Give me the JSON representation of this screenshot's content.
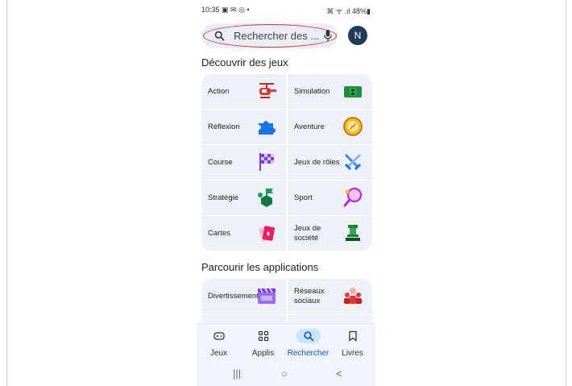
{
  "status_bar": {
    "time": "10:35",
    "notif_icons": "▣ ✉ ◎ •",
    "right_indicators": "⌘ ᯤ .ıl 48%▮"
  },
  "search": {
    "placeholder": "Rechercher des ...",
    "icon": "search-icon",
    "mic_icon": "mic-icon"
  },
  "account": {
    "initial": "N"
  },
  "discover": {
    "title": "Découvrir des jeux",
    "categories": [
      {
        "label": "Action",
        "icon": "helicopter-icon",
        "color": "#e53935"
      },
      {
        "label": "Simulation",
        "icon": "simulation-icon",
        "color": "#1e8e3e"
      },
      {
        "label": "Réflexion",
        "icon": "puzzle-icon",
        "color": "#1a73e8"
      },
      {
        "label": "Aventure",
        "icon": "compass-icon",
        "color": "#f29900"
      },
      {
        "label": "Course",
        "icon": "checkered-flag-icon",
        "color": "#7b3fe4"
      },
      {
        "label": "Jeux de rôles",
        "icon": "crossed-swords-icon",
        "color": "#4285f4"
      },
      {
        "label": "Stratégie",
        "icon": "chess-piece-icon",
        "color": "#0f9d58"
      },
      {
        "label": "Sport",
        "icon": "tennis-racket-icon",
        "color": "#c026d3"
      },
      {
        "label": "Cartes",
        "icon": "cards-icon",
        "color": "#e91e63"
      },
      {
        "label": "Jeux de société",
        "icon": "board-game-piece-icon",
        "color": "#188038"
      }
    ]
  },
  "apps": {
    "title": "Parcourir les applications",
    "categories": [
      {
        "label": "Divertissement",
        "icon": "clapperboard-icon",
        "color": "#7b3fe4"
      },
      {
        "label": "Réseaux sociaux",
        "icon": "people-icon",
        "color": "#e53935"
      }
    ]
  },
  "bottom_nav": [
    {
      "label": "Jeux",
      "icon": "gamepad-icon",
      "active": false
    },
    {
      "label": "Applis",
      "icon": "apps-grid-icon",
      "active": false
    },
    {
      "label": "Rechercher",
      "icon": "search-icon",
      "active": true
    },
    {
      "label": "Livres",
      "icon": "bookmark-icon",
      "active": false
    }
  ],
  "system_nav": {
    "recents": "|||",
    "home": "○",
    "back": "<"
  }
}
